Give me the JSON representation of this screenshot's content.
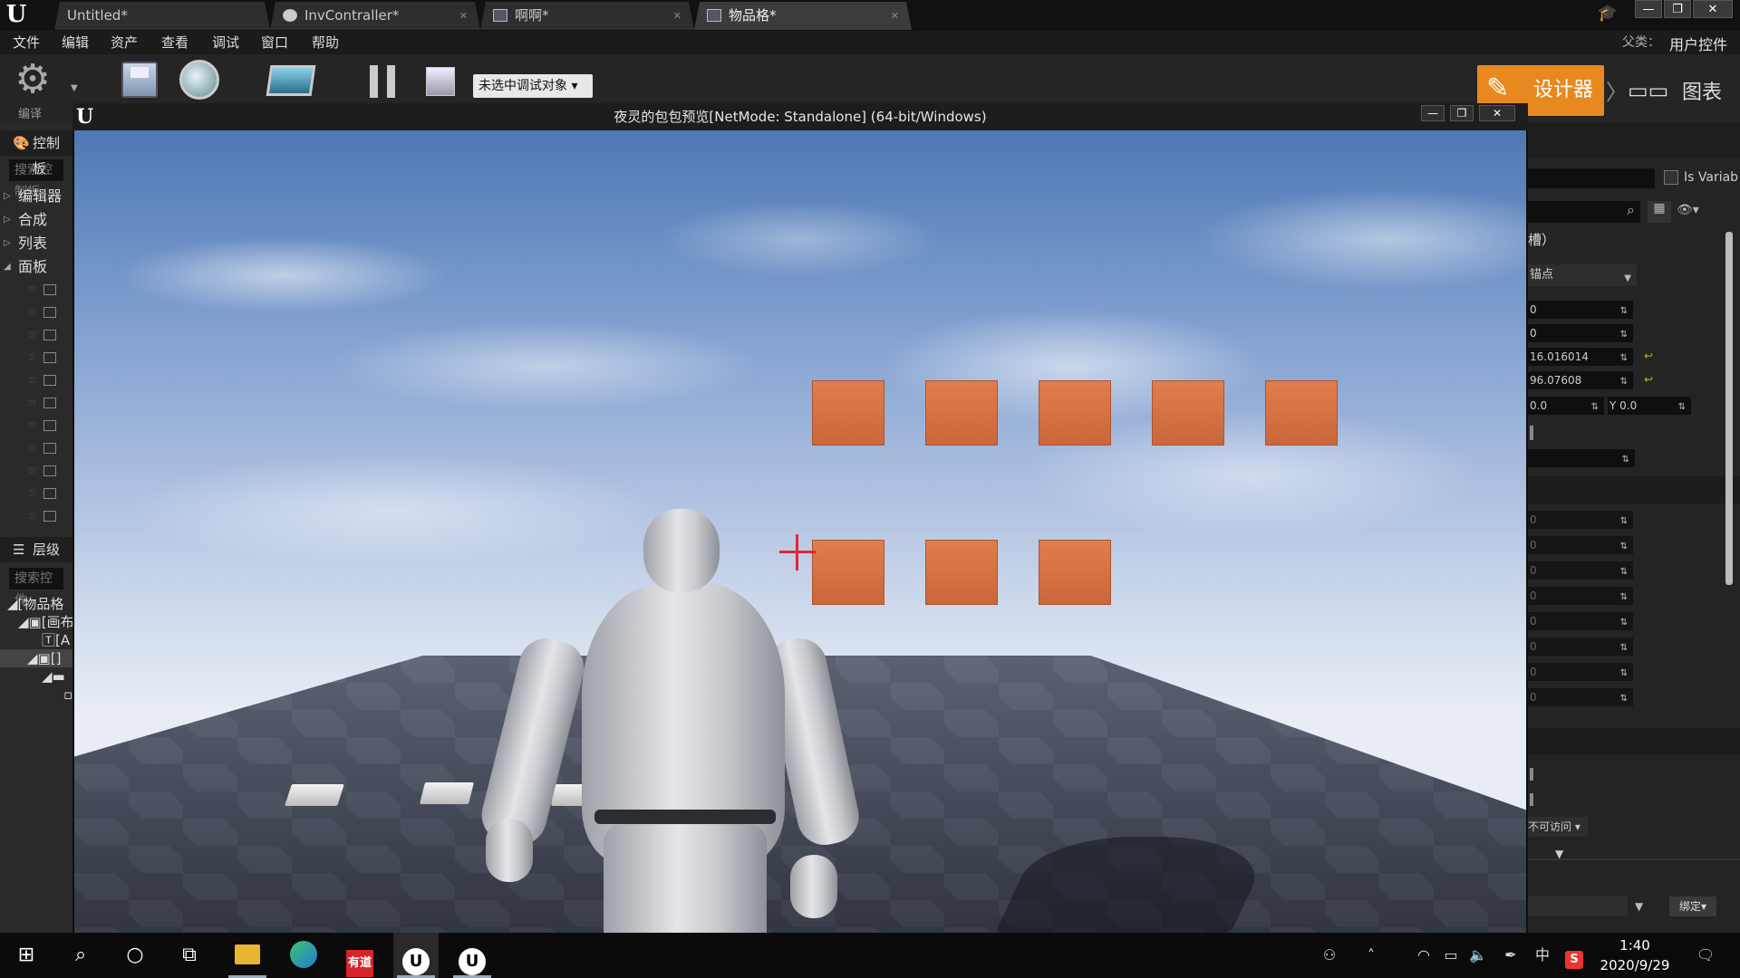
{
  "tabbar": {
    "tabs": [
      {
        "label": "Untitled*",
        "icon": "none"
      },
      {
        "label": "InvContraller*",
        "icon": "blueprint-icon"
      },
      {
        "label": "啊啊*",
        "icon": "widget-icon"
      },
      {
        "label": "物品格*",
        "icon": "widget-icon"
      }
    ],
    "window_buttons": {
      "minimize": "—",
      "maximize": "❐",
      "close": "✕"
    }
  },
  "menubar": {
    "items": [
      "文件",
      "编辑",
      "资产",
      "查看",
      "调试",
      "窗口",
      "帮助"
    ],
    "parent_label": "父类：",
    "parent_value": "用户控件"
  },
  "toolbar": {
    "compile_label": "编译",
    "debug_select": "未选中调试对象",
    "designer": "设计器",
    "graph": "图表"
  },
  "left_panel": {
    "palette_header": "控制板",
    "palette_search": "搜索控制板",
    "categories": [
      "编辑器",
      "合成",
      "列表",
      "面板"
    ],
    "hierarchy_header": "层级",
    "hierarchy_search": "搜索控件",
    "tree": [
      "[物品格",
      "[画布",
      "[A",
      "[]"
    ]
  },
  "right_panel": {
    "is_variable": "Is Variab",
    "slot_label": "槽）",
    "anchor": "锚点",
    "fields": [
      "0",
      "0",
      "16.016014",
      "96.07608"
    ],
    "alignment_x": "0.0",
    "alignment_y_label": "Y",
    "alignment_y": "0.0",
    "dim_fields": [
      "0",
      "0",
      "0",
      "0",
      "0",
      "0",
      "0",
      "0"
    ],
    "visibility": "不可访问",
    "bind": "绑定"
  },
  "preview": {
    "title": "夜灵的包包预览[NetMode: Standalone] (64-bit/Windows)",
    "slot_rows": [
      5,
      3
    ]
  },
  "taskbar": {
    "apps": [
      "windows-start-icon",
      "search-icon",
      "cortana-icon",
      "task-view-icon",
      "file-explorer-icon",
      "edge-icon",
      "youdao-icon",
      "unreal-icon",
      "unreal-icon"
    ],
    "youdao_label": "有道",
    "ime": "中",
    "time": "1:40",
    "date": "2020/9/29"
  },
  "colors": {
    "accent_orange": "#e8891f",
    "slot_orange": "#d97245",
    "crosshair_red": "#e3263a"
  }
}
